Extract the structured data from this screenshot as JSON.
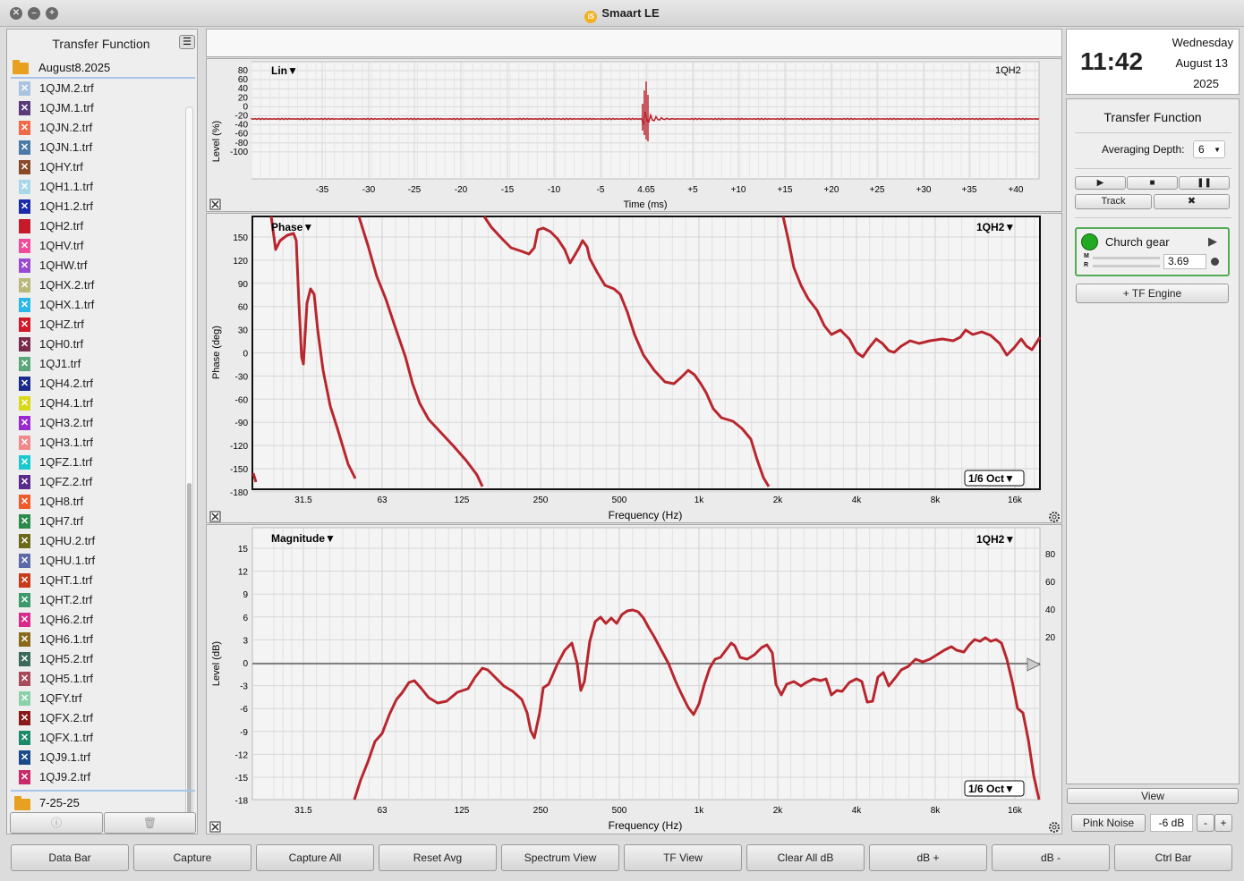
{
  "window": {
    "title": "Smaart LE"
  },
  "sidebar": {
    "title": "Transfer Function",
    "folder1": "August8.2025",
    "folder2": "7-25-25",
    "files": [
      {
        "name": "1QJM.2.trf",
        "color": "#a8c4e0"
      },
      {
        "name": "1QJM.1.trf",
        "color": "#5a3a7a"
      },
      {
        "name": "1QJN.2.trf",
        "color": "#f06a4a"
      },
      {
        "name": "1QJN.1.trf",
        "color": "#4a7aa8"
      },
      {
        "name": "1QHY.trf",
        "color": "#8a4a2a"
      },
      {
        "name": "1QH1.1.trf",
        "color": "#a8d8e8"
      },
      {
        "name": "1QH1.2.trf",
        "color": "#1a2aa8"
      },
      {
        "name": "1QH2.trf",
        "color": "#c41a2a"
      },
      {
        "name": "1QHV.trf",
        "color": "#f04a9a"
      },
      {
        "name": "1QHW.trf",
        "color": "#9a4ad0"
      },
      {
        "name": "1QHX.2.trf",
        "color": "#b8b87a"
      },
      {
        "name": "1QHX.1.trf",
        "color": "#2ab8e8"
      },
      {
        "name": "1QHZ.trf",
        "color": "#d01a2a"
      },
      {
        "name": "1QH0.trf",
        "color": "#7a2a4a"
      },
      {
        "name": "1QJ1.trf",
        "color": "#5aa87a"
      },
      {
        "name": "1QH4.2.trf",
        "color": "#1a2a8a"
      },
      {
        "name": "1QH4.1.trf",
        "color": "#d8d81a"
      },
      {
        "name": "1QH3.2.trf",
        "color": "#9a2ad0"
      },
      {
        "name": "1QH3.1.trf",
        "color": "#f08a8a"
      },
      {
        "name": "1QFZ.1.trf",
        "color": "#1ac8d0"
      },
      {
        "name": "1QFZ.2.trf",
        "color": "#5a2a8a"
      },
      {
        "name": "1QH8.trf",
        "color": "#f05a2a"
      },
      {
        "name": "1QH7.trf",
        "color": "#2a8a4a"
      },
      {
        "name": "1QHU.2.trf",
        "color": "#6a6a1a"
      },
      {
        "name": "1QHU.1.trf",
        "color": "#5a6aa8"
      },
      {
        "name": "1QHT.1.trf",
        "color": "#c83a1a"
      },
      {
        "name": "1QHT.2.trf",
        "color": "#3a9a6a"
      },
      {
        "name": "1QH6.2.trf",
        "color": "#d82a8a"
      },
      {
        "name": "1QH6.1.trf",
        "color": "#8a6a1a"
      },
      {
        "name": "1QH5.2.trf",
        "color": "#3a6a5a"
      },
      {
        "name": "1QH5.1.trf",
        "color": "#a84a5a"
      },
      {
        "name": "1QFY.trf",
        "color": "#8ad0a8"
      },
      {
        "name": "1QFX.2.trf",
        "color": "#8a1a1a"
      },
      {
        "name": "1QFX.1.trf",
        "color": "#1a8a6a"
      },
      {
        "name": "1QJ9.1.trf",
        "color": "#1a4a8a"
      },
      {
        "name": "1QJ9.2.trf",
        "color": "#c82a6a"
      }
    ]
  },
  "impulse": {
    "mode": "Lin",
    "trace": "1QH2",
    "ylabel": "Level (%)",
    "xlabel": "Time (ms)",
    "yticks": [
      "80",
      "60",
      "40",
      "20",
      "0",
      "-20",
      "-40",
      "-60",
      "-80",
      "-100"
    ],
    "xticks": [
      "-35",
      "-30",
      "-25",
      "-20",
      "-15",
      "-10",
      "-5",
      "4.65",
      "+5",
      "+10",
      "+15",
      "+20",
      "+25",
      "+30",
      "+35",
      "+40"
    ]
  },
  "phase": {
    "mode": "Phase",
    "trace": "1QH2",
    "ylabel": "Phase (deg)",
    "xlabel": "Frequency (Hz)",
    "smoothing": "1/6 Oct",
    "yticks": [
      "150",
      "120",
      "90",
      "60",
      "30",
      "0",
      "-30",
      "-60",
      "-90",
      "-120",
      "-150",
      "-180"
    ],
    "xticks": [
      "31.5",
      "63",
      "125",
      "250",
      "500",
      "1k",
      "2k",
      "4k",
      "8k",
      "16k"
    ]
  },
  "magnitude": {
    "mode": "Magnitude",
    "trace": "1QH2",
    "ylabel": "Level (dB)",
    "xlabel": "Frequency (Hz)",
    "smoothing": "1/6 Oct",
    "yticks": [
      "15",
      "12",
      "9",
      "6",
      "3",
      "0",
      "-3",
      "-6",
      "-9",
      "-12",
      "-15",
      "-18"
    ],
    "coh_ticks": [
      "80",
      "60",
      "40",
      "20"
    ],
    "xticks": [
      "31.5",
      "63",
      "125",
      "250",
      "500",
      "1k",
      "2k",
      "4k",
      "8k",
      "16k"
    ]
  },
  "clock": {
    "time": "11:42",
    "day": "Wednesday",
    "date": "August 13",
    "year": "2025"
  },
  "tf": {
    "title": "Transfer Function",
    "avg_label": "Averaging Depth:",
    "avg_value": "6",
    "track_label": "Track",
    "engine_name": "Church gear",
    "delay": "3.69",
    "m_label": "M",
    "r_label": "R",
    "add_engine": "+ TF Engine",
    "view_label": "View",
    "pink_noise": "Pink Noise",
    "noise_level": "-6 dB",
    "minus": "-",
    "plus": "+"
  },
  "bottom_buttons": [
    "Data Bar",
    "Capture",
    "Capture All",
    "Reset Avg",
    "Spectrum View",
    "TF View",
    "Clear All dB",
    "dB +",
    "dB -",
    "Ctrl Bar"
  ],
  "colors": {
    "trace": "#b8262e",
    "engine_on": "#22aa22"
  }
}
